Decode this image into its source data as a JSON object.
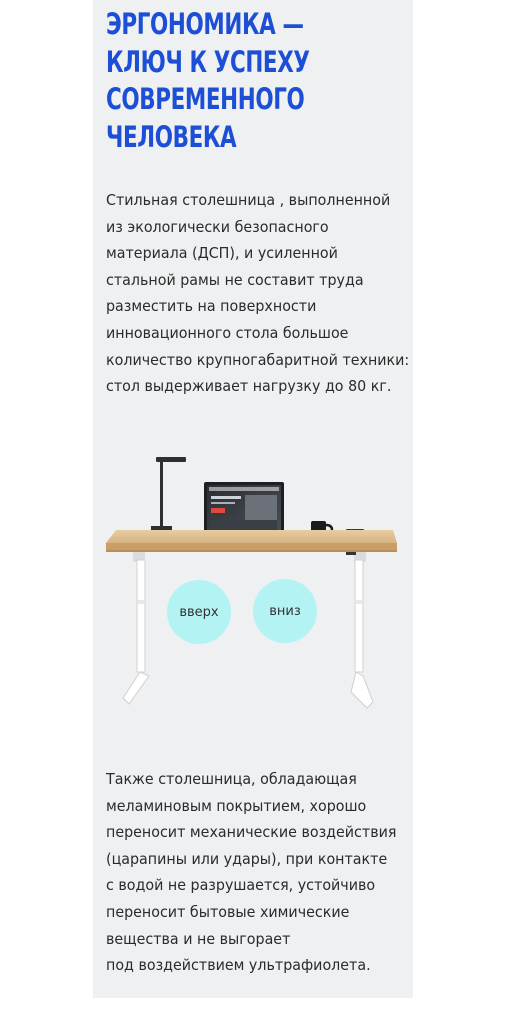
{
  "heading": {
    "lines": [
      "Эргономика —",
      "ключ к успеху",
      "современного",
      "человека"
    ],
    "color": "#1c4fd6"
  },
  "paragraph1": {
    "lines": [
      "Стильная столешница , выполненной",
      "из экологически безопасного",
      "материала (ДСП), и усиленной",
      "стальной рамы не составит труда",
      "разместить на поверхности",
      "инновационного стола большое",
      "количество крупногабаритной техники:",
      "стол выдерживает нагрузку до 80 кг."
    ]
  },
  "desk_controls": {
    "up_label": "вверх",
    "down_label": "вниз",
    "button_color": "#b3f3f4"
  },
  "paragraph2": {
    "lines": [
      "Также столешница, обладающая",
      "меламиновым покрытием, хорошо",
      "переносит механические воздействия",
      "(царапины или удары), при контакте",
      "с водой не разрушается, устойчиво",
      "переносит бытовые химические",
      "вещества и не выгорает",
      "под воздействием ультрафиолета."
    ]
  },
  "panel_background": "#eef0f1"
}
